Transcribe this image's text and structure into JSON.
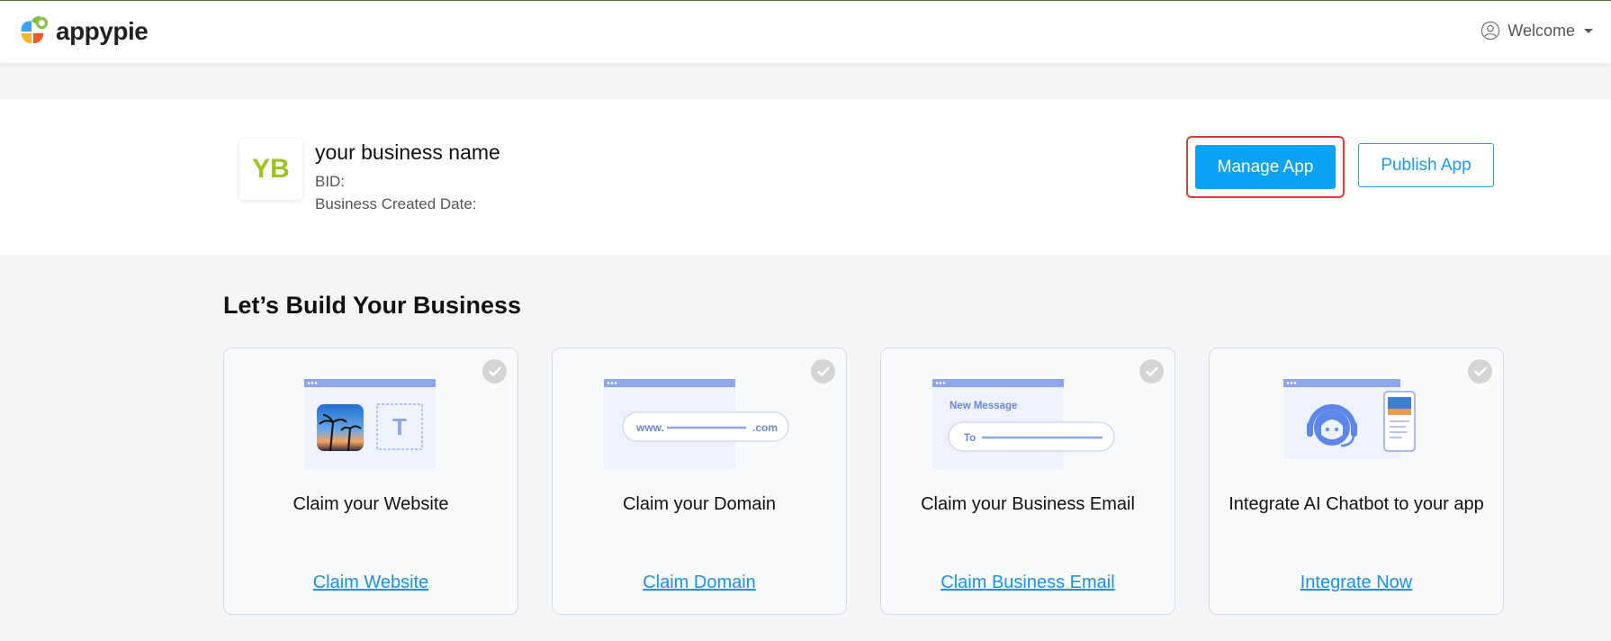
{
  "header": {
    "brand": "appypie",
    "user_menu_label": "Welcome"
  },
  "business": {
    "initials": "YB",
    "name": "your business name",
    "bid_label": "BID:",
    "created_label": "Business Created Date:",
    "manage_button": "Manage App",
    "publish_button": "Publish App"
  },
  "section": {
    "title": "Let’s Build Your Business"
  },
  "cards": [
    {
      "title": "Claim your Website",
      "link": "Claim Website",
      "illustration_text": "T",
      "icon": "website-icon",
      "completed": false
    },
    {
      "title": "Claim your Domain",
      "link": "Claim Domain",
      "illustration_text_prefix": "www.",
      "illustration_text_suffix": ".com",
      "icon": "domain-icon",
      "completed": false
    },
    {
      "title": "Claim your Business Email",
      "link": "Claim Business Email",
      "illustration_heading": "New Message",
      "illustration_to": "To",
      "icon": "email-icon",
      "completed": false
    },
    {
      "title": "Integrate AI Chatbot to your app",
      "link": "Integrate Now",
      "icon": "chatbot-icon",
      "completed": false
    }
  ],
  "colors": {
    "primary": "#0aa2f5",
    "highlight_border": "#e53935",
    "link": "#1f8fe0",
    "brand_initials": "#9ac31c",
    "illustration": "#8ea4ec"
  }
}
